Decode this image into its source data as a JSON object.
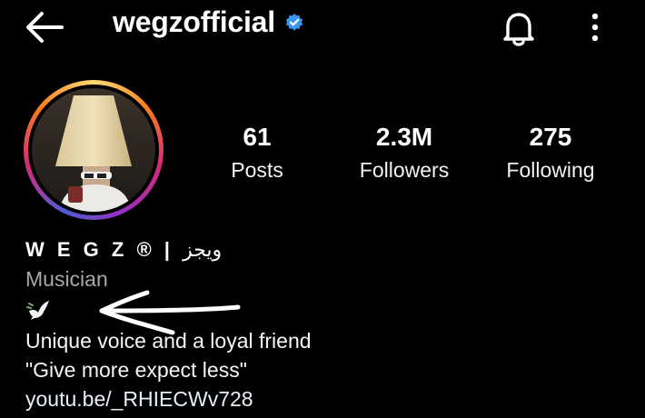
{
  "header": {
    "back_icon": "arrow-left-icon",
    "username": "wegzofficial",
    "verified_icon": "verified-badge-icon",
    "verified_color": "#3897f0",
    "bell_icon": "bell-icon",
    "more_icon": "kebab-menu-icon"
  },
  "avatar": {
    "ring_colors": [
      "#feda75",
      "#fa7e1e",
      "#d62976",
      "#962fbf",
      "#4f5bd5"
    ]
  },
  "stats": [
    {
      "value": "61",
      "label": "Posts"
    },
    {
      "value": "2.3M",
      "label": "Followers"
    },
    {
      "value": "275",
      "label": "Following"
    }
  ],
  "bio": {
    "name_latin": "W E G Z ®",
    "name_separator": "|",
    "name_arabic": "ويجز",
    "category": "Musician",
    "emoji_icon": "dove-icon",
    "lines": [
      "Unique voice and a loyal friend",
      "\"Give more expect less\""
    ],
    "link": "youtu.be/_RHIECWv728"
  },
  "annotation": {
    "arrow_icon": "hand-drawn-arrow-icon",
    "color": "#ffffff"
  }
}
